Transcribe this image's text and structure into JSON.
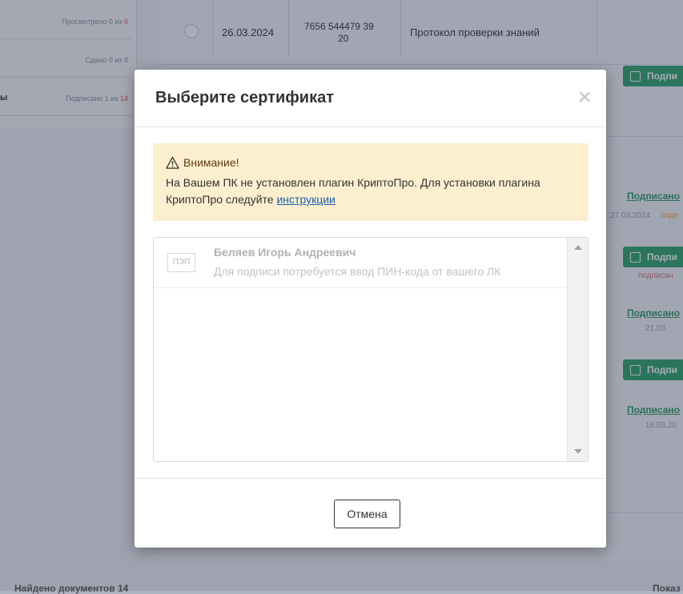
{
  "background": {
    "left_panel": [
      {
        "label": "",
        "count": "Просмотрено 0 из ",
        "count_hl": "6"
      },
      {
        "label": "",
        "count": "Сдано 0 из 8",
        "count_hl": ""
      },
      {
        "label": "ы",
        "count": "Подписано 1 из ",
        "count_hl": "14"
      }
    ],
    "table": {
      "row1": {
        "date": "26.03.2024",
        "number_line1": "7656 544479 39",
        "number_line2": "20",
        "name": "Протокол проверки знаний"
      }
    },
    "sign_button": "Подпи",
    "signed_link": "Подписано",
    "dates": [
      "27.03.2024",
      "21.03.",
      "18.03.20"
    ],
    "status_small": "подп",
    "signed_hint": "подписан",
    "found_text": "Найдено документов 14",
    "found_right": "Показ"
  },
  "modal": {
    "title": "Выберите сертификат",
    "close_icon": "close-icon",
    "alert": {
      "icon": "warning-icon",
      "title": "Внимание!",
      "text_before": "На Вашем ПК не установлен плагин КриптоПро. Для установки плагина КриптоПро следуйте ",
      "link": "инструкции"
    },
    "certificates": [
      {
        "badge": "ПЭП",
        "name": "Беляев Игорь Андреевич",
        "note": "Для подписи потребуется ввод ПИН-кода от вашего ЛК"
      }
    ],
    "cancel_label": "Отмена"
  },
  "colors": {
    "alert_bg": "#fcefd0",
    "link": "#1a5fb4",
    "green": "#2fa36b"
  }
}
